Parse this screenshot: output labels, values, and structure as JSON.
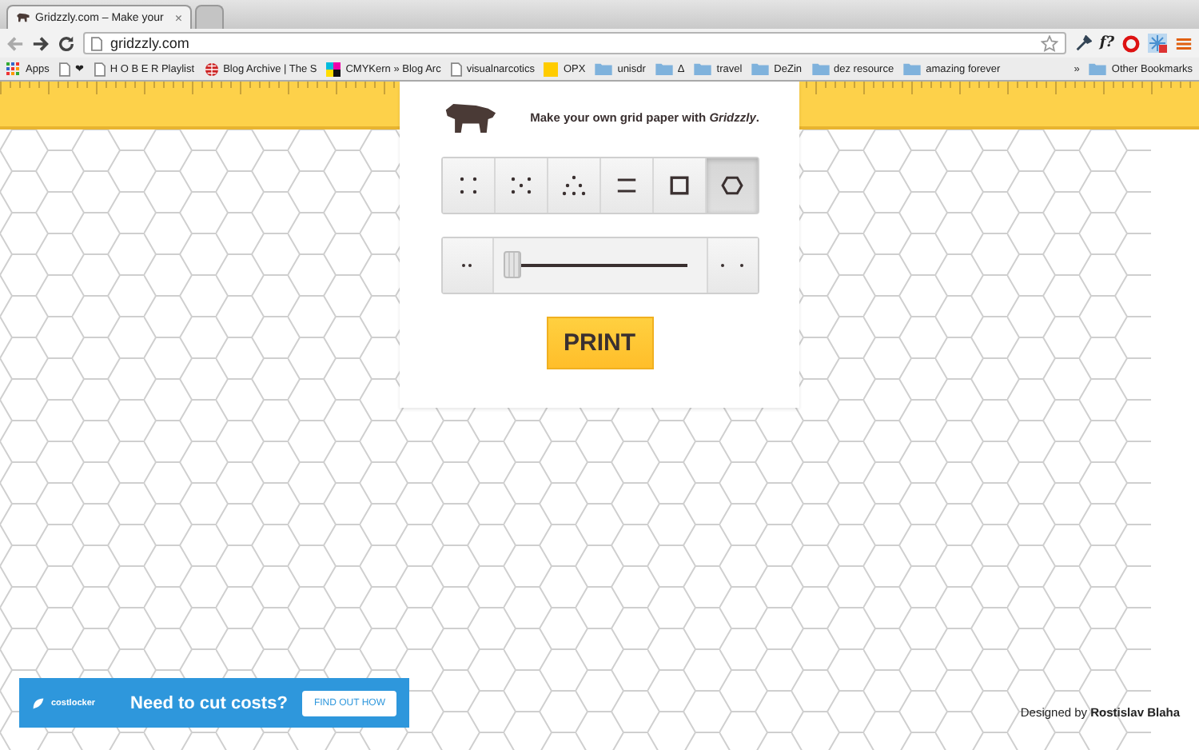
{
  "browser": {
    "tabs": [
      {
        "kind": "page",
        "title": "Gridzzly.com – Make your",
        "close": "×",
        "selected": true
      },
      {
        "kind": "new",
        "selected": false
      }
    ],
    "url": "gridzzly.com",
    "extension_label": "f?",
    "bookmarks": [
      {
        "kind": "apps",
        "label": "Apps"
      },
      {
        "kind": "page",
        "label": "❤"
      },
      {
        "kind": "page",
        "label": "H O B E R Playlist"
      },
      {
        "kind": "globe",
        "label": "Blog Archive | The S"
      },
      {
        "kind": "cmyk",
        "label": "CMYKern » Blog Arc"
      },
      {
        "kind": "page",
        "label": "visualnarcotics"
      },
      {
        "kind": "square",
        "label": "OPX"
      },
      {
        "kind": "folder",
        "label": "unisdr"
      },
      {
        "kind": "folder",
        "label": "Δ"
      },
      {
        "kind": "folder",
        "label": "travel"
      },
      {
        "kind": "folder",
        "label": "DeZin"
      },
      {
        "kind": "folder",
        "label": "dez resource"
      },
      {
        "kind": "folder",
        "label": "amazing forever"
      }
    ],
    "overflow": "»",
    "other_bookmarks": "Other Bookmarks"
  },
  "card": {
    "tagline": "Make your own grid paper with *Gridzzly*.",
    "grid_types": [
      {
        "kind": "dots",
        "selected": false
      },
      {
        "kind": "dots-offset",
        "selected": false
      },
      {
        "kind": "dots-triangle",
        "selected": false
      },
      {
        "kind": "lines",
        "selected": false
      },
      {
        "kind": "square",
        "selected": false
      },
      {
        "kind": "hexagon",
        "selected": true
      }
    ],
    "size_slider": {
      "level": 0.02
    },
    "print_button": "PRINT"
  },
  "ad": {
    "brand": "costlocker",
    "headline": "Need to cut costs?",
    "button": "FIND OUT HOW"
  },
  "credit": "Designed by **Rostislav Blaha**"
}
